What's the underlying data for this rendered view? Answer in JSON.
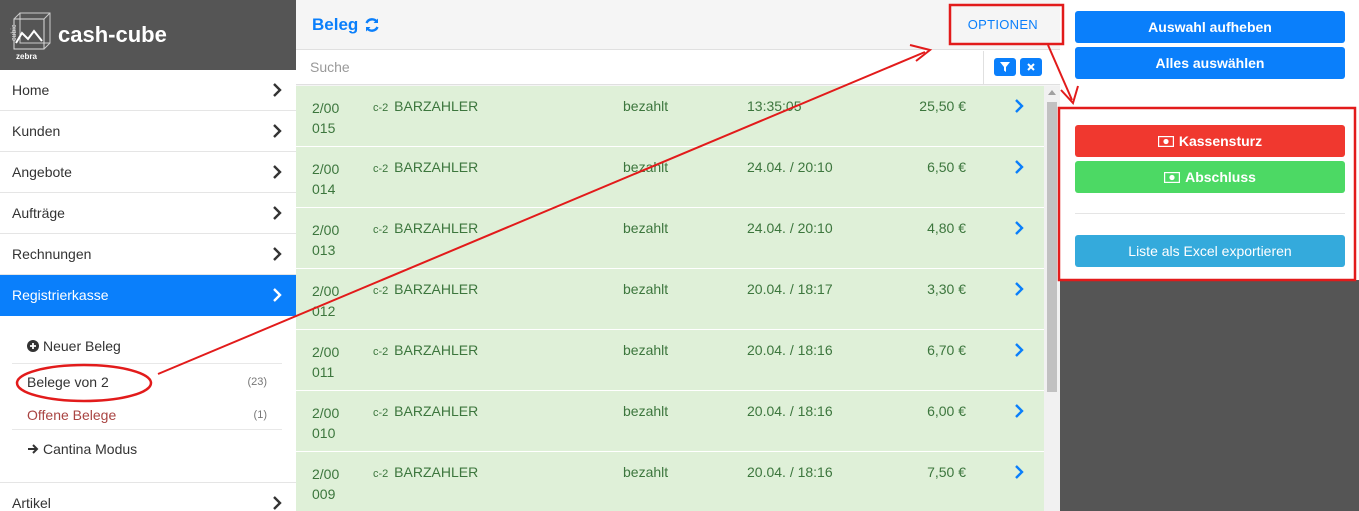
{
  "brand": {
    "name": "cash-cube",
    "logo_text_top": "cubic",
    "logo_text_bottom": "zebra"
  },
  "nav": [
    {
      "label": "Home",
      "active": false
    },
    {
      "label": "Kunden",
      "active": false
    },
    {
      "label": "Angebote",
      "active": false
    },
    {
      "label": "Aufträge",
      "active": false
    },
    {
      "label": "Rechnungen",
      "active": false
    },
    {
      "label": "Registrierkasse",
      "active": true
    }
  ],
  "subnav": {
    "new_receipt": "Neuer Beleg",
    "receipts_label": "Belege von 2",
    "receipts_count": "(23)",
    "open_label": "Offene Belege",
    "open_count": "(1)",
    "cantina": "Cantina Modus"
  },
  "artikel": "Artikel",
  "main": {
    "title": "Beleg",
    "options": "OPTIONEN",
    "search_placeholder": "Suche"
  },
  "rows": [
    {
      "num1": "2/00",
      "num2": "015",
      "prefix": "c-2",
      "customer": "BARZAHLER",
      "status": "bezahlt",
      "time": "13:35:05",
      "amount": "25,50 €"
    },
    {
      "num1": "2/00",
      "num2": "014",
      "prefix": "c-2",
      "customer": "BARZAHLER",
      "status": "bezahlt",
      "time": "24.04. / 20:10",
      "amount": "6,50 €"
    },
    {
      "num1": "2/00",
      "num2": "013",
      "prefix": "c-2",
      "customer": "BARZAHLER",
      "status": "bezahlt",
      "time": "24.04. / 20:10",
      "amount": "4,80 €"
    },
    {
      "num1": "2/00",
      "num2": "012",
      "prefix": "c-2",
      "customer": "BARZAHLER",
      "status": "bezahlt",
      "time": "20.04. / 18:17",
      "amount": "3,30 €"
    },
    {
      "num1": "2/00",
      "num2": "011",
      "prefix": "c-2",
      "customer": "BARZAHLER",
      "status": "bezahlt",
      "time": "20.04. / 18:16",
      "amount": "6,70 €"
    },
    {
      "num1": "2/00",
      "num2": "010",
      "prefix": "c-2",
      "customer": "BARZAHLER",
      "status": "bezahlt",
      "time": "20.04. / 18:16",
      "amount": "6,00 €"
    },
    {
      "num1": "2/00",
      "num2": "009",
      "prefix": "c-2",
      "customer": "BARZAHLER",
      "status": "bezahlt",
      "time": "20.04. / 18:16",
      "amount": "7,50 €"
    }
  ],
  "panel": {
    "deselect_all": "Auswahl aufheben",
    "select_all": "Alles auswählen",
    "cash_count": "Kassensturz",
    "closing": "Abschluss",
    "export_excel": "Liste als Excel exportieren"
  },
  "colors": {
    "accent": "#0a7ffb",
    "row_bg": "#dff0d8",
    "row_text": "#3c763d",
    "danger": "#f0382f",
    "success": "#4cd964",
    "info": "#34aadc",
    "annotation": "#e21b1b"
  }
}
